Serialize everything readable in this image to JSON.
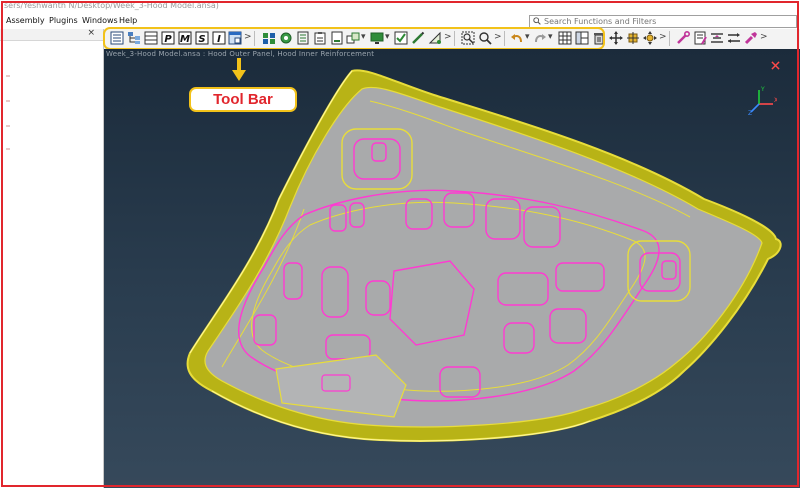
{
  "window": {
    "title_fragment": "sers/Yeshwanth N/Desktop/Week_3-Hood Model.ansa)"
  },
  "menubar": {
    "items": [
      {
        "label": "Assembly"
      },
      {
        "label": "Plugins"
      },
      {
        "label": "Windows"
      },
      {
        "label": "Help"
      }
    ]
  },
  "search": {
    "placeholder": "Search Functions and Filters"
  },
  "left_panel": {
    "close_glyph": "×"
  },
  "toolbar": {
    "more_glyph": ">",
    "dropdown_glyph": "▾",
    "groups": [
      {
        "name": "part-tools",
        "icons": [
          "list-icon",
          "tree-icon",
          "table-icon",
          "bold-p-icon",
          "bold-m-icon",
          "bold-s-icon",
          "italic-i-icon",
          "window-icon"
        ]
      },
      {
        "name": "model-tools",
        "icons": [
          "properties-icon",
          "gear-icon",
          "document-icon",
          "clipboard-icon",
          "report-icon",
          "transform-icon",
          "display-icon",
          "checkbox-icon",
          "pen-icon",
          "measure-icon"
        ]
      },
      {
        "name": "view-tools",
        "icons": [
          "zoom-fit-icon",
          "zoom-icon"
        ]
      },
      {
        "name": "edit-tools",
        "icons": [
          "undo-icon",
          "redo-icon",
          "grid-icon",
          "layout-icon",
          "delete-icon",
          "rotate-icon",
          "orbit-icon",
          "pan-icon"
        ]
      },
      {
        "name": "utility-tools",
        "icons": [
          "wrench-icon",
          "notes-icon",
          "align-icon",
          "switch-icon",
          "paint-icon"
        ]
      }
    ]
  },
  "viewport": {
    "caption": "Week_3-Hood Model.ansa : Hood Outer Panel, Hood Inner Reinforcement"
  },
  "annotation": {
    "label": "Tool Bar",
    "color": "#e1262d",
    "border_color": "#f2c21a"
  },
  "triad": {
    "x_label": "X",
    "y_label": "Y",
    "z_label": "Z"
  },
  "colors": {
    "frame": "#e1262d",
    "highlight": "#f2c21a",
    "feature_lines": "#ff3ad2",
    "edge_lines": "#e8dd3a",
    "surface": "#a9aaab",
    "viewport_top": "#1b2b3b",
    "viewport_bottom": "#36495b"
  }
}
